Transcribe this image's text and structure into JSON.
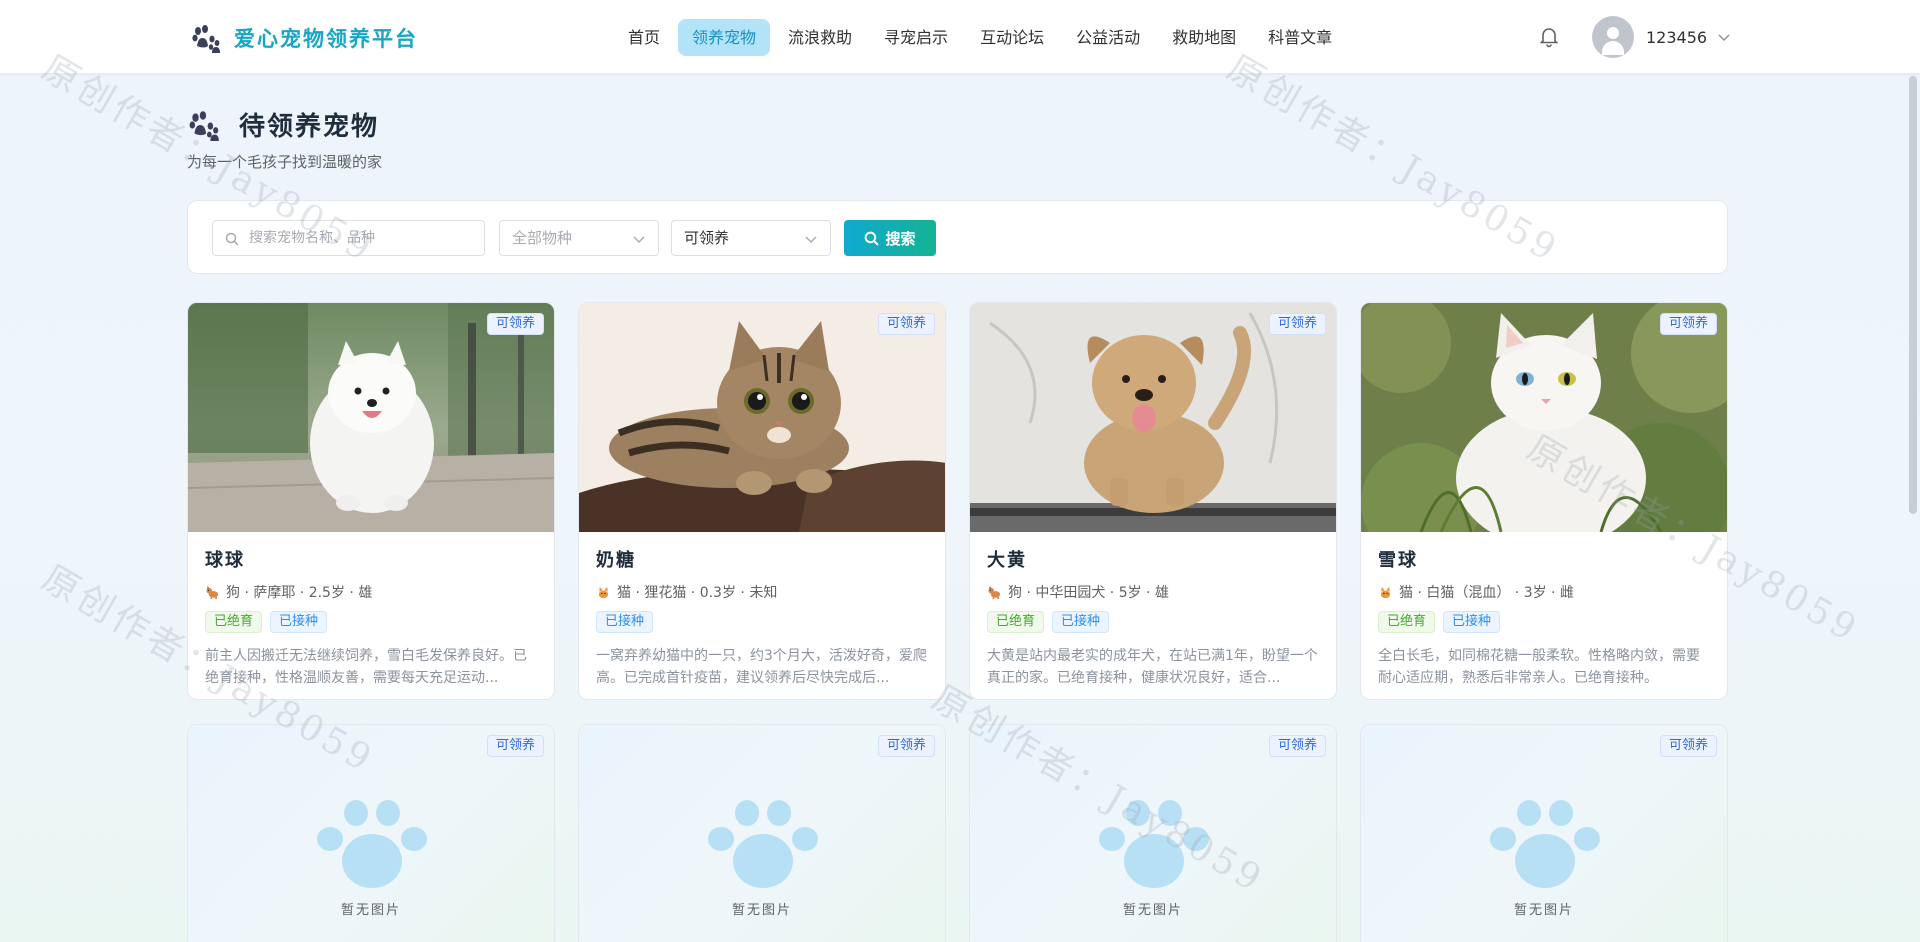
{
  "header": {
    "brand": "爱心宠物领养平台",
    "nav": [
      {
        "label": "首页",
        "active": false
      },
      {
        "label": "领养宠物",
        "active": true
      },
      {
        "label": "流浪救助",
        "active": false
      },
      {
        "label": "寻宠启示",
        "active": false
      },
      {
        "label": "互动论坛",
        "active": false
      },
      {
        "label": "公益活动",
        "active": false
      },
      {
        "label": "救助地图",
        "active": false
      },
      {
        "label": "科普文章",
        "active": false
      }
    ],
    "username": "123456",
    "icons": {
      "brand": "paw-icon",
      "notifications": "bell-icon",
      "avatar": "user-icon",
      "menu": "chevron-down-icon"
    }
  },
  "page": {
    "title": "待领养宠物",
    "subtitle": "为每一个毛孩子找到温暖的家"
  },
  "filters": {
    "search_placeholder": "搜索宠物名称、品种",
    "species_placeholder": "全部物种",
    "status_value": "可领养",
    "search_button": "搜索"
  },
  "cards": [
    {
      "name": "球球",
      "badge": "可领养",
      "species_icon": "dog-icon",
      "meta": "狗 · 萨摩耶 · 2.5岁 · 雄",
      "tags": [
        {
          "label": "已绝育",
          "color": "green"
        },
        {
          "label": "已接种",
          "color": "blue"
        }
      ],
      "description": "前主人因搬迁无法继续饲养，雪白毛发保养良好。已绝育接种，性格温顺友善，需要每天充足运动..."
    },
    {
      "name": "奶糖",
      "badge": "可领养",
      "species_icon": "cat-icon",
      "meta": "猫 · 狸花猫 · 0.3岁 · 未知",
      "tags": [
        {
          "label": "已接种",
          "color": "blue"
        }
      ],
      "description": "一窝弃养幼猫中的一只，约3个月大，活泼好奇，爱爬高。已完成首针疫苗，建议领养后尽快完成后..."
    },
    {
      "name": "大黄",
      "badge": "可领养",
      "species_icon": "dog-icon",
      "meta": "狗 · 中华田园犬 · 5岁 · 雄",
      "tags": [
        {
          "label": "已绝育",
          "color": "green"
        },
        {
          "label": "已接种",
          "color": "blue"
        }
      ],
      "description": "大黄是站内最老实的成年犬，在站已满1年，盼望一个真正的家。已绝育接种，健康状况良好，适合..."
    },
    {
      "name": "雪球",
      "badge": "可领养",
      "species_icon": "cat-icon",
      "meta": "猫 · 白猫（混血） · 3岁 · 雌",
      "tags": [
        {
          "label": "已绝育",
          "color": "green"
        },
        {
          "label": "已接种",
          "color": "blue"
        }
      ],
      "description": "全白长毛，如同棉花糖一般柔软。性格略内敛，需要耐心适应期，熟悉后非常亲人。已绝育接种。"
    }
  ],
  "placeholder_cards": [
    {
      "badge": "可领养",
      "empty_text": "暂无图片"
    },
    {
      "badge": "可领养",
      "empty_text": "暂无图片"
    },
    {
      "badge": "可领养",
      "empty_text": "暂无图片"
    },
    {
      "badge": "可领养",
      "empty_text": "暂无图片"
    }
  ],
  "watermark": "原创作者：Jay8059",
  "colors": {
    "brand": "#19a6c4",
    "accent": "#13b394",
    "nav_active_bg": "#b3e3f8"
  }
}
